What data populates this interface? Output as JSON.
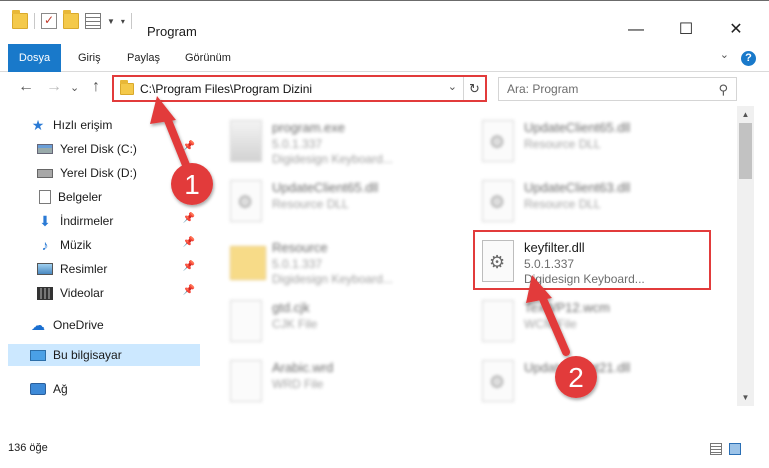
{
  "window": {
    "title": "Program",
    "min_glyph": "—",
    "max_glyph": "☐",
    "close_glyph": "✕"
  },
  "ribbon": {
    "tabs": [
      "Dosya",
      "Giriş",
      "Paylaş",
      "Görünüm"
    ],
    "help_glyph": "?"
  },
  "nav": {
    "back_glyph": "←",
    "forward_glyph": "→",
    "recent_glyph": "⌄",
    "up_glyph": "↑",
    "address": "C:\\Program Files\\Program Dizini",
    "dropdown_glyph": "⌄",
    "refresh_glyph": "↻",
    "search_placeholder": "Ara: Program",
    "search_glyph": "⚲"
  },
  "sidebar": {
    "items": [
      {
        "label": "Hızlı erişim",
        "icon": "star-icon",
        "pinned": false
      },
      {
        "label": "Yerel Disk (C:)",
        "icon": "drive-c-icon",
        "pinned": true
      },
      {
        "label": "Yerel Disk (D:)",
        "icon": "drive-d-icon",
        "pinned": false
      },
      {
        "label": "Belgeler",
        "icon": "documents-icon",
        "pinned": true
      },
      {
        "label": "İndirmeler",
        "icon": "downloads-icon",
        "pinned": true
      },
      {
        "label": "Müzik",
        "icon": "music-icon",
        "pinned": true
      },
      {
        "label": "Resimler",
        "icon": "pictures-icon",
        "pinned": true
      },
      {
        "label": "Videolar",
        "icon": "videos-icon",
        "pinned": true
      },
      {
        "label": "OneDrive",
        "icon": "onedrive-icon",
        "pinned": false
      },
      {
        "label": "Bu bilgisayar",
        "icon": "this-pc-icon",
        "pinned": false,
        "selected": true
      },
      {
        "label": "Ağ",
        "icon": "network-icon",
        "pinned": false
      }
    ],
    "pin_glyph": "📌"
  },
  "files": [
    {
      "name": "program.exe",
      "meta1": "5.0.1.337",
      "meta2": "Digidesign Keyboard...",
      "kind": "exe",
      "blurred": true
    },
    {
      "name": "UpdateClient65.dll",
      "meta1": "Resource DLL",
      "meta2": "",
      "kind": "gear",
      "blurred": true
    },
    {
      "name": "UpdateClient65.dll",
      "meta1": "Resource DLL",
      "meta2": "",
      "kind": "gear",
      "blurred": true
    },
    {
      "name": "UpdateClient63.dll",
      "meta1": "Resource DLL",
      "meta2": "",
      "kind": "gear",
      "blurred": true
    },
    {
      "name": "Resource",
      "meta1": "5.0.1.337",
      "meta2": "Digidesign Keyboard...",
      "kind": "folder",
      "blurred": true
    },
    {
      "name": "keyfilter.dll",
      "meta1": "5.0.1.337",
      "meta2": "Digidesign Keyboard...",
      "kind": "gear",
      "blurred": false
    },
    {
      "name": "gtd.cjk",
      "meta1": "CJK File",
      "meta2": "",
      "kind": "doc",
      "blurred": true
    },
    {
      "name": "TexWP12.wcm",
      "meta1": "WCM File",
      "meta2": "",
      "kind": "doc",
      "blurred": true
    },
    {
      "name": "Arabic.wrd",
      "meta1": "WRD File",
      "meta2": "",
      "kind": "doc",
      "blurred": true
    },
    {
      "name": "UpdateClient21.dll",
      "meta1": "",
      "meta2": "",
      "kind": "gear",
      "blurred": true
    }
  ],
  "status": {
    "count": "136 öğe"
  },
  "callouts": {
    "one": "1",
    "two": "2",
    "color": "#e23b3b"
  }
}
